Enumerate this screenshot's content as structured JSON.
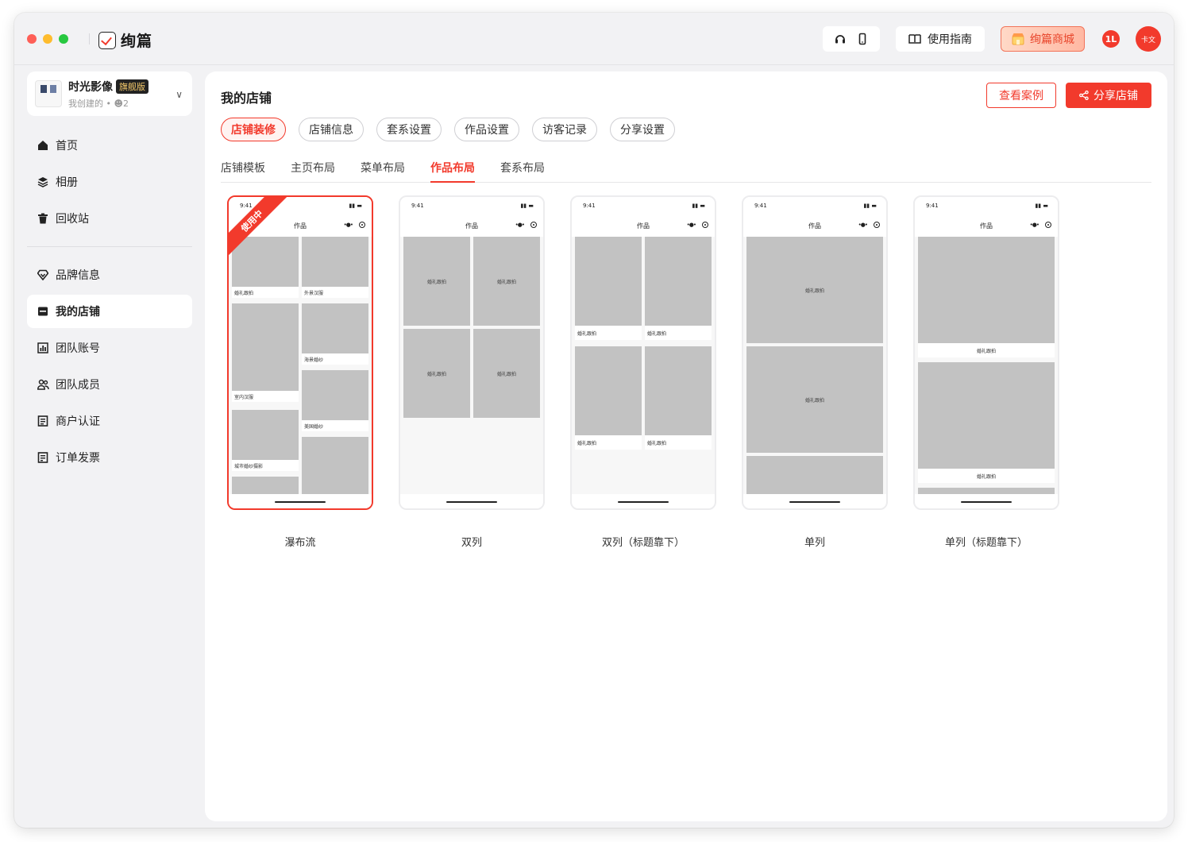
{
  "app": {
    "name": "绚篇"
  },
  "topbar": {
    "guide": "使用指南",
    "mall": "绚篇商城",
    "badge": "1L",
    "avatar": "卡文"
  },
  "studio": {
    "name": "时光影像",
    "tag": "旗舰版",
    "sub": "我创建的 • ",
    "members": "2"
  },
  "nav": {
    "group1": [
      {
        "label": "首页",
        "icon": "home-icon"
      },
      {
        "label": "相册",
        "icon": "layers-icon"
      },
      {
        "label": "回收站",
        "icon": "trash-icon"
      }
    ],
    "group2": [
      {
        "label": "品牌信息",
        "icon": "diamond-icon"
      },
      {
        "label": "我的店铺",
        "icon": "store-icon",
        "active": true
      },
      {
        "label": "团队账号",
        "icon": "chart-icon"
      },
      {
        "label": "团队成员",
        "icon": "users-icon"
      },
      {
        "label": "商户认证",
        "icon": "document-icon"
      },
      {
        "label": "订单发票",
        "icon": "invoice-icon"
      }
    ]
  },
  "main": {
    "title": "我的店铺",
    "btn_case": "查看案例",
    "btn_share": "分享店铺",
    "pills": [
      "店铺装修",
      "店铺信息",
      "套系设置",
      "作品设置",
      "访客记录",
      "分享设置"
    ],
    "active_pill": 0,
    "subtabs": [
      "店铺模板",
      "主页布局",
      "菜单布局",
      "作品布局",
      "套系布局"
    ],
    "active_subtab": 3
  },
  "layouts": {
    "ribbon": "使用中",
    "phone": {
      "time": "9:41",
      "header": "作品"
    },
    "captions": {
      "wedding": "婚礼跟拍",
      "outdoor": "外景汉服",
      "indoor": "室内汉服",
      "sea": "海景婚纱",
      "classic": "美国婚纱",
      "city": "城市婚纱摄影"
    },
    "items": [
      {
        "label": "瀑布流",
        "selected": true
      },
      {
        "label": "双列"
      },
      {
        "label": "双列（标题靠下）"
      },
      {
        "label": "单列"
      },
      {
        "label": "单列（标题靠下）"
      }
    ]
  },
  "colors": {
    "accent": "#f23a2c"
  }
}
